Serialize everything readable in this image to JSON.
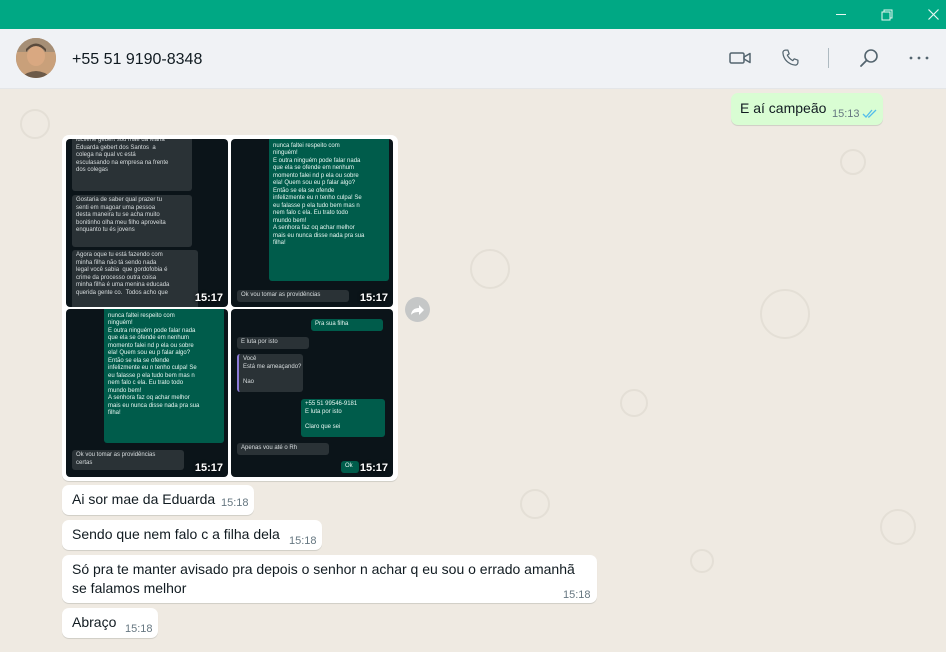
{
  "header": {
    "contact_name": "+55 51 9190-8348"
  },
  "messages": [
    {
      "text": "E aí campeão",
      "time": "15:13",
      "direction": "out",
      "status": "read"
    },
    {
      "text": "Ai sor mae da Eduarda",
      "time": "15:18"
    },
    {
      "text": "Sendo que nem falo c a filha dela",
      "time": "15:18"
    },
    {
      "text_line1": "Só pra te manter avisado pra depois o senhor n achar q eu sou o errado amanhã",
      "text_line2": "se falamos melhor",
      "time": "15:18"
    },
    {
      "text": "Abraço",
      "time": "15:18"
    }
  ],
  "album": {
    "images": [
      {
        "time": "15:17",
        "bubbles": [
          {
            "text": "lucilene gebert sou mãe da Maria\nEduarda gebert dos Santos  a\ncolega na qual vc está\nesculasando na empresa na frente\ndos colegas",
            "time": "15:00"
          },
          {
            "text": "Gostaria de saber qual prazer tu\nsenti em magoar uma pessoa\ndesta maneira tu se acha muito\nbonitinho olha meu filho aproveita\nenquanto tu és jovens",
            "time": "15:01"
          },
          {
            "text": "Agora oque tu está fazendo com\nminha filha não tá sendo nada\nlegal você sabia  que gordofobia é\ncrime da processo outra coisa\nminha filha é uma menina educada\nquerida gente co.  Todos acho que",
            "time": ""
          }
        ]
      },
      {
        "time": "15:17",
        "bubbles": [
          {
            "text": "Me dou bem com todo mundo\nnunca faltei respeito com\nninguém!\nE outra ninguém pode falar nada\nque ela se ofende em nenhum\nmomento falei nd p ela ou sobre\nela! Quem sou eu p falar algo?\nEntão se ela se ofende\ninfelizmente eu n tenho culpa! Se\neu falasse p ela tudo bem mas n\nnem falo c ela. Eu trato todo\nmundo bem!\nA senhora faz oq achar melhor\nmais eu nunca disse nada pra sua\nfilha!",
            "time": "15:11"
          },
          {
            "text": "Ok vou tomar as providências",
            "time": ""
          }
        ]
      },
      {
        "time": "15:17",
        "bubbles": [
          {
            "text": "Me dou bem com todo mundo\nnunca faltei respeito com\nninguém!\nE outra ninguém pode falar nada\nque ela se ofende em nenhum\nmomento falei nd p ela ou sobre\nela! Quem sou eu p falar algo?\nEntão se ela se ofende\ninfelizmente eu n tenho culpa! Se\neu falasse p ela tudo bem mas n\nnem falo c ela. Eu trato todo\nmundo bem!\nA senhora faz oq achar melhor\nmais eu nunca disse nada pra sua\nfilha!",
            "time": "15:11"
          },
          {
            "text": "Ok vou tomar as providências\ncertas",
            "time": "15:12"
          }
        ]
      },
      {
        "time": "15:17",
        "bubbles": [
          {
            "text": "Pra sua filha",
            "time": "15:15"
          },
          {
            "text": "E luta por isto",
            "time": "15:16"
          },
          {
            "text": "Você\nEstá me ameaçando?\n\nNao",
            "time": "15:16"
          },
          {
            "text": "+55 51 99546-9181\nE luta por isto\n\nClaro que sei",
            "time": "15:16"
          },
          {
            "text": "Apenas vou até o Rh",
            "time": "15:16"
          },
          {
            "text": "Ok",
            "time": ""
          }
        ]
      }
    ]
  }
}
